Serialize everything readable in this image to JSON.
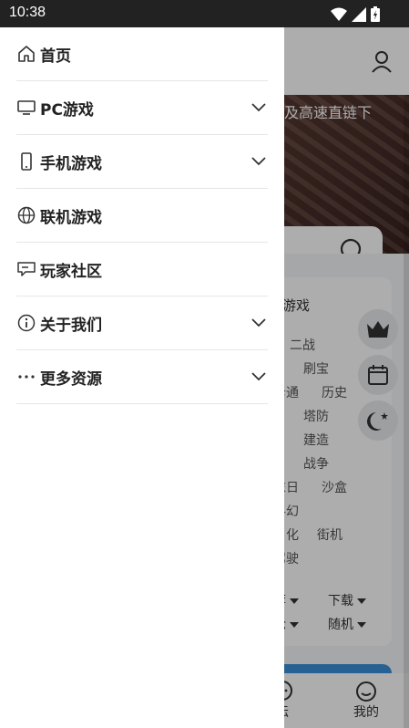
{
  "status_bar": {
    "time": "10:38"
  },
  "drawer": {
    "items": [
      {
        "label": "首页",
        "icon": "home-icon",
        "has_submenu": false
      },
      {
        "label": "PC游戏",
        "icon": "monitor-icon",
        "has_submenu": true
      },
      {
        "label": "手机游戏",
        "icon": "phone-icon",
        "has_submenu": true
      },
      {
        "label": "联机游戏",
        "icon": "globe-icon",
        "has_submenu": false
      },
      {
        "label": "玩家社区",
        "icon": "chat-icon",
        "has_submenu": false
      },
      {
        "label": "关于我们",
        "icon": "info-icon",
        "has_submenu": true
      },
      {
        "label": "更多资源",
        "icon": "more-icon",
        "has_submenu": true
      }
    ]
  },
  "background": {
    "banner_tagline": "以及高速直链下",
    "card_title": "游戏",
    "tags": [
      "二战",
      "刷宝",
      "卡通",
      "历史",
      "塔防",
      "建造",
      "战争",
      "末日",
      "沙盒",
      "科幻",
      "化",
      "街机",
      "驾驶"
    ],
    "sort_dropdowns": [
      "荐",
      "下载",
      "论",
      "随机"
    ],
    "bottom_nav": {
      "forum_label": "坛",
      "mine_label": "我的"
    }
  },
  "colors": {
    "status_bar": "#222222",
    "scrim": "rgba(0,0,0,0.32)",
    "accent_blue": "#3a8fd9"
  }
}
